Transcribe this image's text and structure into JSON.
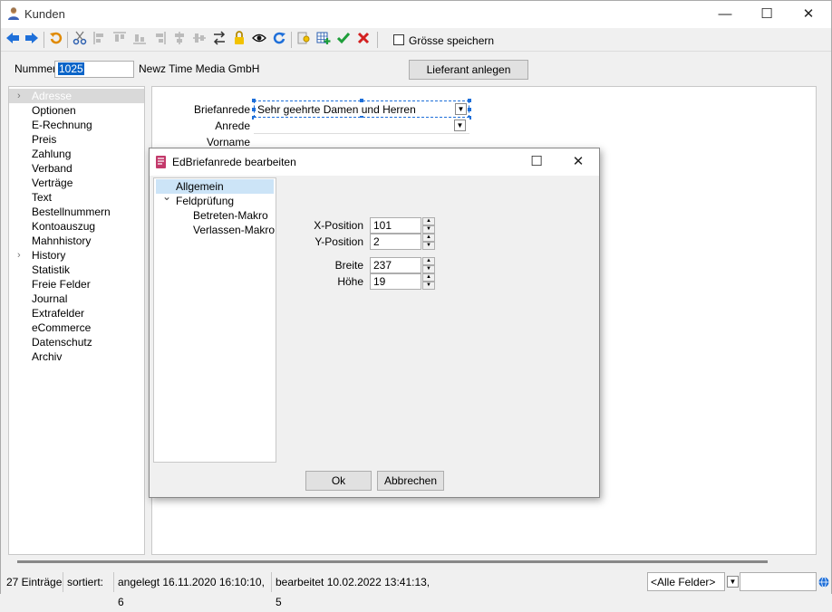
{
  "window": {
    "title": "Kunden",
    "minimize": "—",
    "maximize": "☐",
    "close": "✕"
  },
  "toolbar": {
    "icons": [
      "arrow-left-icon",
      "arrow-right-icon",
      "undo-icon",
      "cut-icon",
      "align-left-icon",
      "align-top-icon",
      "align-bottom-icon",
      "align-right-icon",
      "center-horizontal-icon",
      "center-vertical-icon",
      "tab-order-icon",
      "lock-icon",
      "eye-icon",
      "redo-icon",
      "key-icon",
      "grid-add-icon",
      "check-icon",
      "cross-icon"
    ],
    "groesse_label": "Grösse speichern"
  },
  "header": {
    "nummer_label": "Nummer",
    "nummer_value": "1025",
    "company": "Newz Time Media GmbH",
    "lieferant_button": "Lieferant anlegen"
  },
  "nav": {
    "items": [
      {
        "label": "Adresse",
        "arrow": "›"
      },
      {
        "label": "Optionen"
      },
      {
        "label": "E-Rechnung"
      },
      {
        "label": "Preis"
      },
      {
        "label": "Zahlung"
      },
      {
        "label": "Verband"
      },
      {
        "label": "Verträge"
      },
      {
        "label": "Text"
      },
      {
        "label": "Bestellnummern"
      },
      {
        "label": "Kontoauszug"
      },
      {
        "label": "Mahnhistory"
      },
      {
        "label": "History",
        "arrow": "›"
      },
      {
        "label": "Statistik"
      },
      {
        "label": "Freie Felder"
      },
      {
        "label": "Journal"
      },
      {
        "label": "Extrafelder"
      },
      {
        "label": "eCommerce"
      },
      {
        "label": "Datenschutz"
      },
      {
        "label": "Archiv"
      }
    ]
  },
  "form": {
    "briefanrede_label": "Briefanrede",
    "briefanrede_value": "Sehr geehrte Damen und Herren",
    "anrede_label": "Anrede",
    "vorname_label": "Vorname"
  },
  "dialog": {
    "title": "EdBriefanrede bearbeiten",
    "maximize": "☐",
    "close": "✕",
    "tree": {
      "allgemein": "Allgemein",
      "feldpruefung": "Feldprüfung",
      "expander": "⌄",
      "betreten": "Betreten-Makro",
      "verlassen": "Verlassen-Makro"
    },
    "fields": {
      "x_label": "X-Position",
      "x_value": "101",
      "y_label": "Y-Position",
      "y_value": "2",
      "breite_label": "Breite",
      "breite_value": "237",
      "hoehe_label": "Höhe",
      "hoehe_value": "19"
    },
    "ok": "Ok",
    "abbrechen": "Abbrechen"
  },
  "status": {
    "count": "27 Einträge",
    "sortiert": "sortiert:",
    "angelegt": "angelegt 16.11.2020 16:10:10,  6",
    "bearbeitet": "bearbeitet 10.02.2022 13:41:13,  5",
    "filter": "<Alle Felder>"
  },
  "colors": {
    "accent": "#1e6fd9",
    "selection": "#cce4f7",
    "accent_dark": "#0a64c8"
  }
}
